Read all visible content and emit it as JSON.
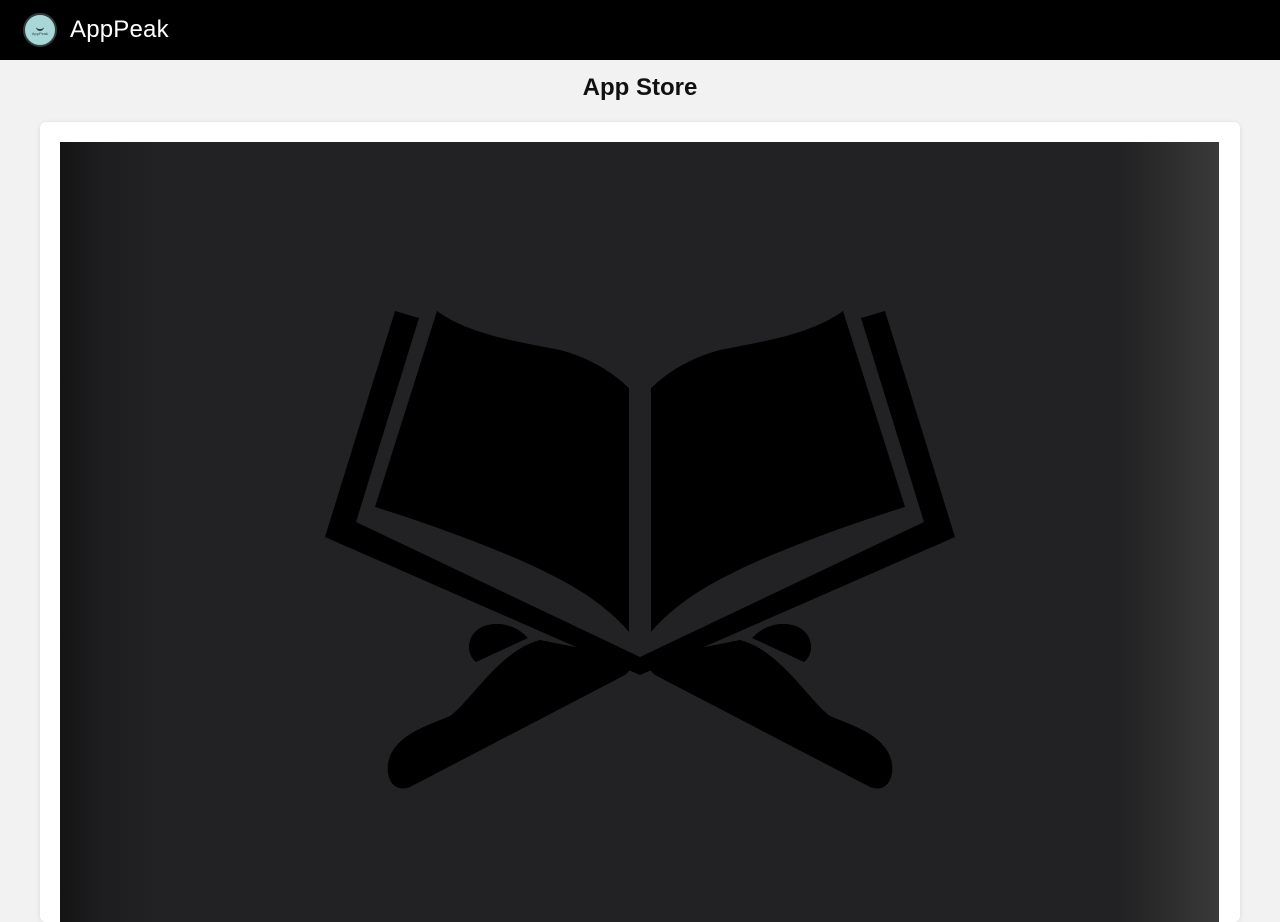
{
  "header": {
    "brand": "AppPeak",
    "logo_text": "AppPeak",
    "logo_icon": "book-stand-logo-icon"
  },
  "page": {
    "title": "App Store"
  },
  "hero": {
    "icon": "open-book-on-stand-icon",
    "background_color": "#222224",
    "icon_color": "#000000"
  },
  "colors": {
    "topbar": "#000000",
    "page_bg": "#f2f2f2",
    "card_bg": "#ffffff",
    "logo_bg": "#a9d6d6"
  }
}
